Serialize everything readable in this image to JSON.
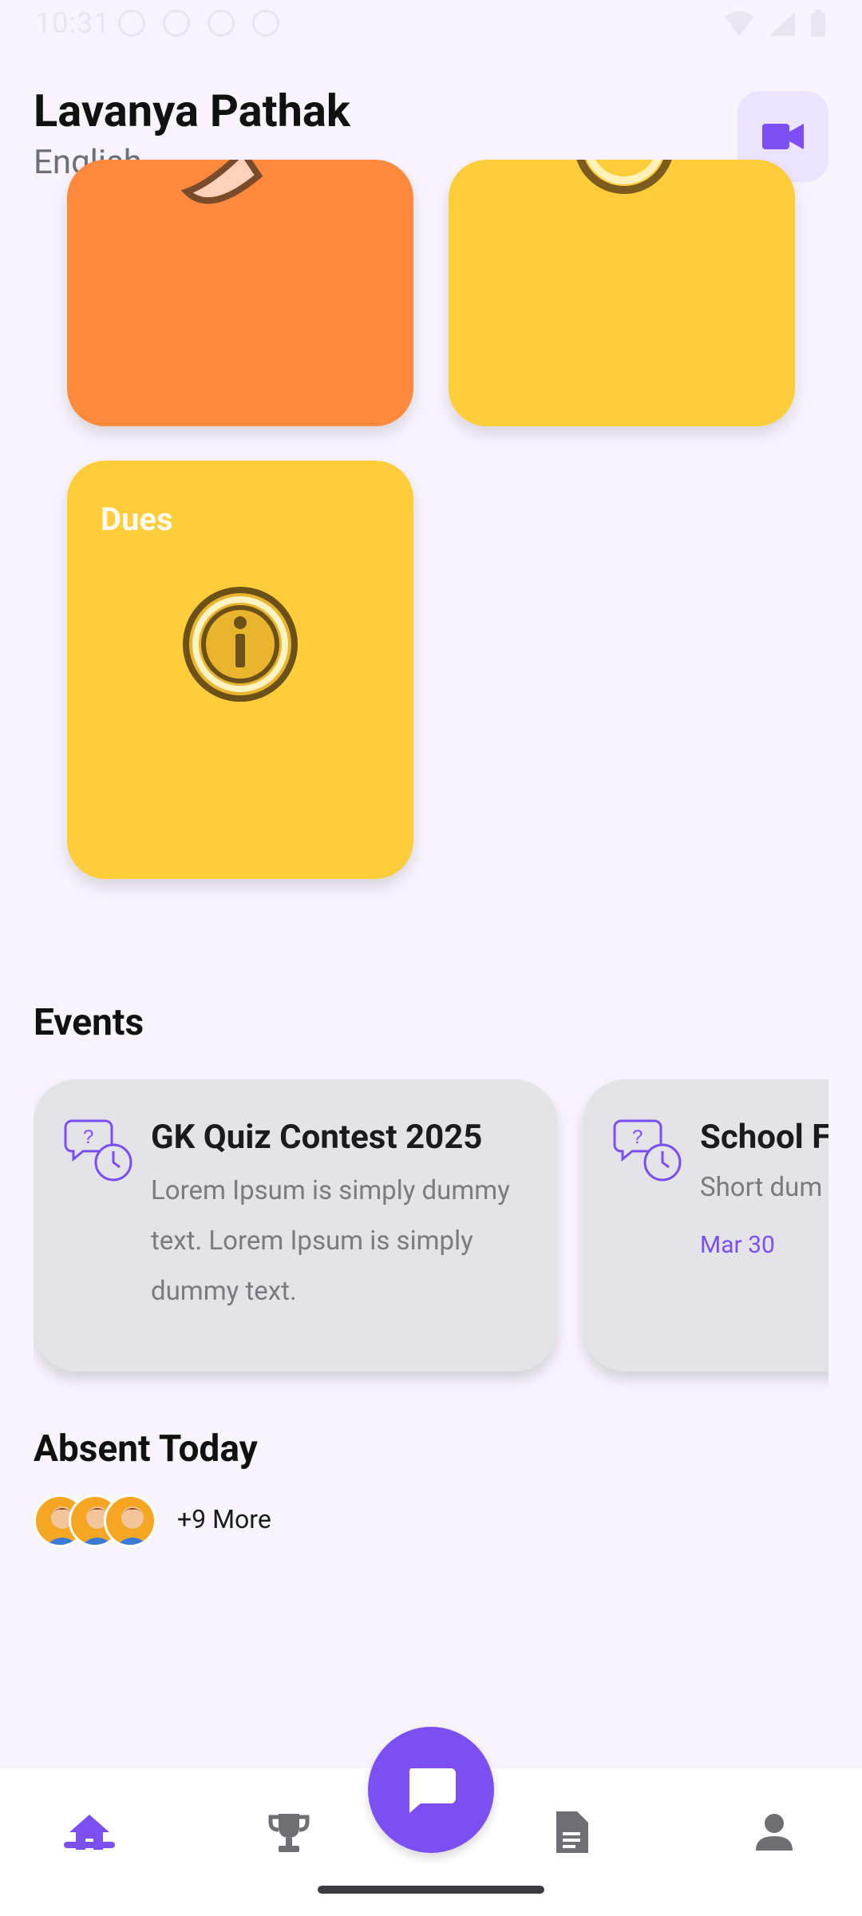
{
  "status_bar": {
    "time": "10:31"
  },
  "header": {
    "name": "Lavanya Pathak",
    "subtitle": "English",
    "video_icon": "video-camera-icon",
    "accent": "#7b4ff2"
  },
  "cards": [
    {
      "label": "",
      "color": "#ff8a3d"
    },
    {
      "label": "",
      "color": "#ffcc3a"
    },
    {
      "label": "Dues",
      "color": "#ffcc3a",
      "icon": "info-icon"
    }
  ],
  "events": {
    "title": "Events",
    "items": [
      {
        "title": "GK Quiz Contest 2025",
        "description": "Lorem Ipsum is simply dummy text. Lorem Ipsum is simply dummy text.",
        "date": ""
      },
      {
        "title": "School F",
        "description": "Short dum",
        "date": "Mar 30"
      }
    ]
  },
  "absent": {
    "title": "Absent Today",
    "more_label": "+9 More"
  },
  "bottom_nav": {
    "items": [
      {
        "name": "home",
        "icon": "home-icon",
        "active": true
      },
      {
        "name": "achievements",
        "icon": "trophy-icon",
        "active": false
      },
      {
        "name": "chat",
        "icon": "chat-icon",
        "active": false
      },
      {
        "name": "documents",
        "icon": "document-icon",
        "active": false
      },
      {
        "name": "profile",
        "icon": "person-icon",
        "active": false
      }
    ]
  }
}
